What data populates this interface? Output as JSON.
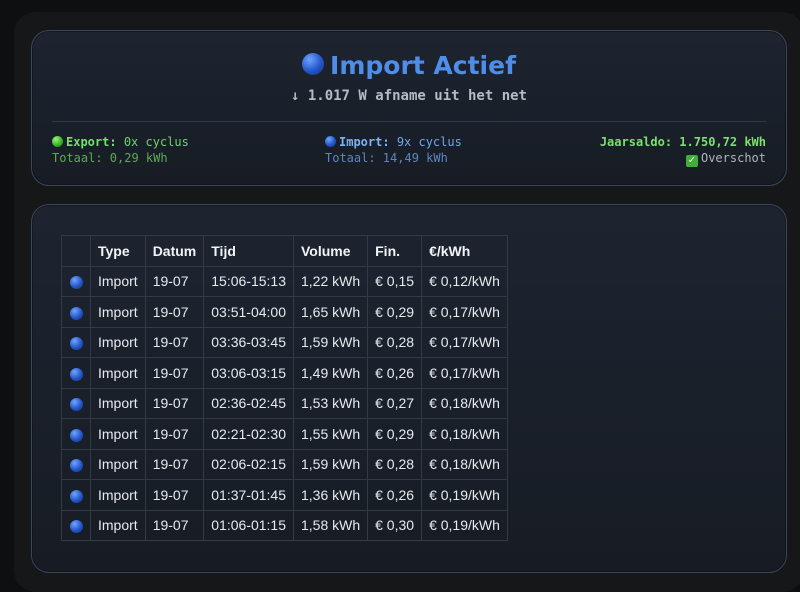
{
  "status": {
    "title": "Import Actief",
    "title_icon": "blue-circle-icon",
    "subtitle": "↓ 1.017 W afname uit het net",
    "export": {
      "label": "Export:",
      "cycles": "0x cyclus",
      "total": "Totaal: 0,29 kWh",
      "icon": "green-circle-icon"
    },
    "import": {
      "label": "Import:",
      "cycles": "9x cyclus",
      "total": "Totaal: 14,49 kWh",
      "icon": "blue-circle-icon"
    },
    "balance": {
      "label": "Jaarsaldo: 1.750,72 kWh",
      "note": "Overschot",
      "note_icon": "checkmark-icon"
    }
  },
  "table": {
    "headers": [
      "",
      "Type",
      "Datum",
      "Tijd",
      "Volume",
      "Fin.",
      "€/kWh"
    ],
    "rows": [
      [
        "Import",
        "19-07",
        "15:06-15:13",
        "1,22 kWh",
        "€ 0,15",
        "€ 0,12/kWh"
      ],
      [
        "Import",
        "19-07",
        "03:51-04:00",
        "1,65 kWh",
        "€ 0,29",
        "€ 0,17/kWh"
      ],
      [
        "Import",
        "19-07",
        "03:36-03:45",
        "1,59 kWh",
        "€ 0,28",
        "€ 0,17/kWh"
      ],
      [
        "Import",
        "19-07",
        "03:06-03:15",
        "1,49 kWh",
        "€ 0,26",
        "€ 0,17/kWh"
      ],
      [
        "Import",
        "19-07",
        "02:36-02:45",
        "1,53 kWh",
        "€ 0,27",
        "€ 0,18/kWh"
      ],
      [
        "Import",
        "19-07",
        "02:21-02:30",
        "1,55 kWh",
        "€ 0,29",
        "€ 0,18/kWh"
      ],
      [
        "Import",
        "19-07",
        "02:06-02:15",
        "1,59 kWh",
        "€ 0,28",
        "€ 0,18/kWh"
      ],
      [
        "Import",
        "19-07",
        "01:37-01:45",
        "1,36 kWh",
        "€ 0,26",
        "€ 0,19/kWh"
      ],
      [
        "Import",
        "19-07",
        "01:06-01:15",
        "1,58 kWh",
        "€ 0,30",
        "€ 0,19/kWh"
      ]
    ]
  },
  "colors": {
    "accent": "#4f8ee8",
    "export_green": "#74e06d",
    "import_blue": "#7fb2f5"
  }
}
